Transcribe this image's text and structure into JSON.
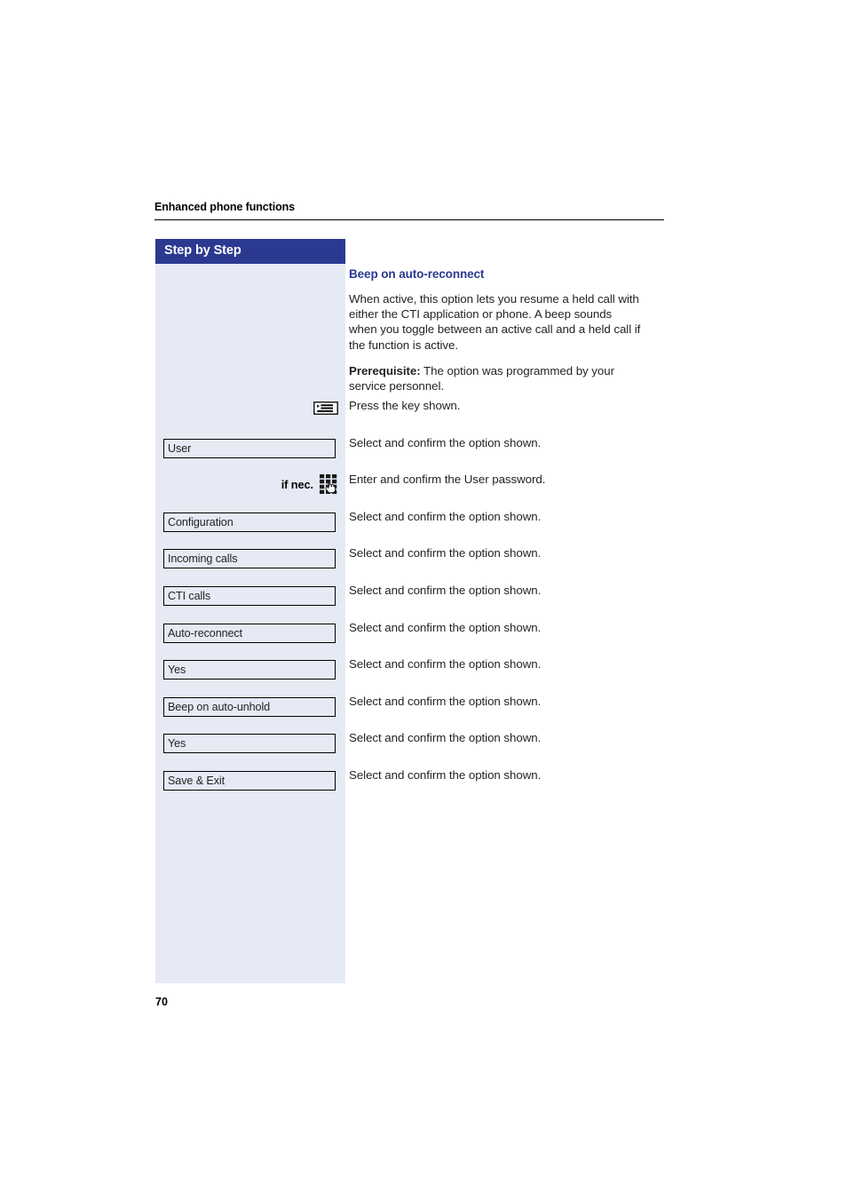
{
  "header": {
    "running_title": "Enhanced phone functions"
  },
  "sidebar": {
    "title": "Step by Step"
  },
  "content": {
    "heading": "Beep on auto-reconnect",
    "paragraphs": [
      "When active, this option lets you resume a held call with either the CTI application or phone. A beep sounds when you toggle between an active call and a held call if the function is active.",
      "The option was programmed by your service personnel."
    ],
    "prerequisite_label": "Prerequisite:"
  },
  "steps": [
    {
      "type": "icon",
      "icon": "menu-key-icon",
      "label": "",
      "instruction": "Press the key shown."
    },
    {
      "type": "option",
      "label": "User",
      "instruction": "Select and confirm the option shown."
    },
    {
      "type": "icon",
      "icon": "keypad-icon",
      "prefix": "if nec.",
      "label": "",
      "instruction": "Enter and confirm the User password."
    },
    {
      "type": "option",
      "label": "Configuration",
      "instruction": "Select and confirm the option shown."
    },
    {
      "type": "option",
      "label": "Incoming calls",
      "instruction": "Select and confirm the option shown."
    },
    {
      "type": "option",
      "label": "CTI calls",
      "instruction": "Select and confirm the option shown."
    },
    {
      "type": "option",
      "label": "Auto-reconnect",
      "instruction": "Select and confirm the option shown."
    },
    {
      "type": "option",
      "label": "Yes",
      "instruction": "Select and confirm the option shown."
    },
    {
      "type": "option",
      "label": "Beep on auto-unhold",
      "instruction": "Select and confirm the option shown."
    },
    {
      "type": "option",
      "label": "Yes",
      "instruction": "Select and confirm the option shown."
    },
    {
      "type": "option",
      "label": "Save & Exit",
      "instruction": "Select and confirm the option shown."
    }
  ],
  "footer": {
    "page_number": "70"
  },
  "colors": {
    "accent_navy": "#2b3990",
    "sidebar_fill": "#e5eaf5",
    "body_text": "#231f20",
    "rule": "#000000"
  }
}
